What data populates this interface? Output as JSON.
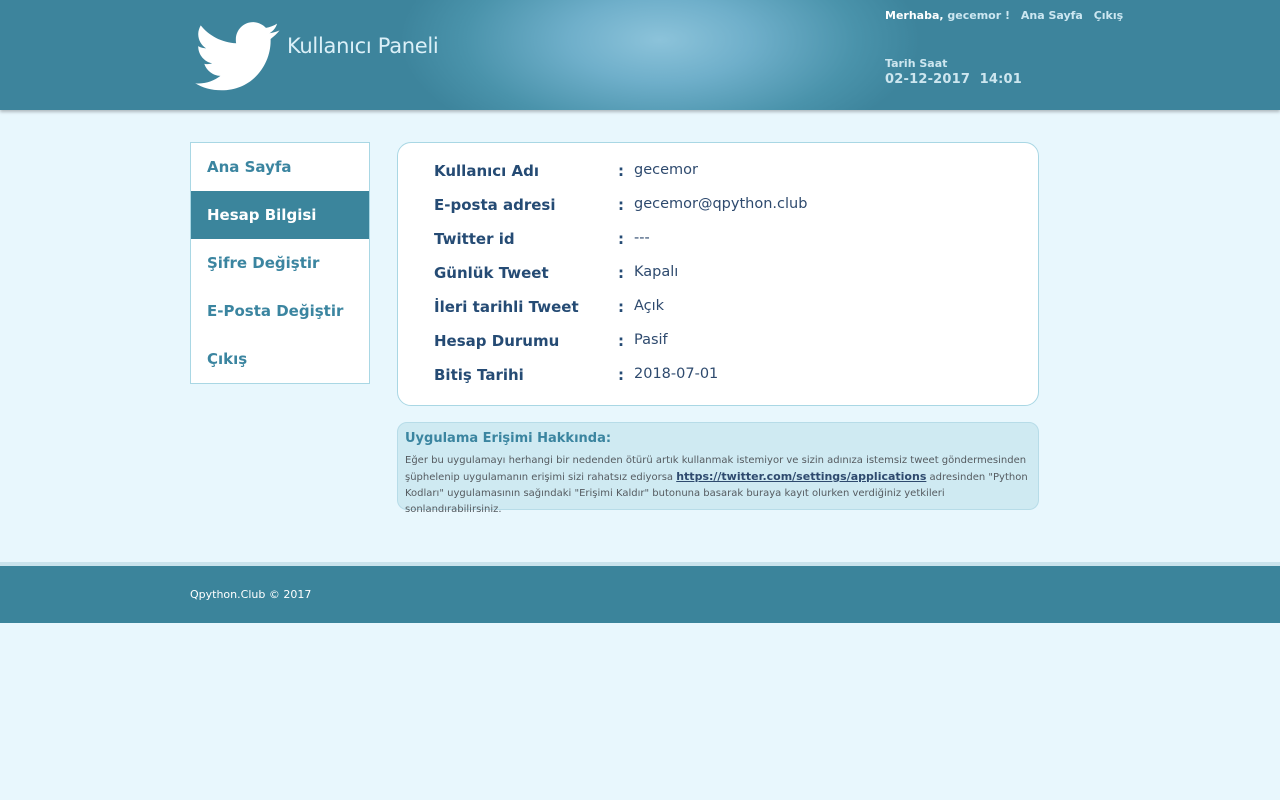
{
  "header": {
    "app_title": "Kullanıcı Paneli",
    "greeting_prefix": "Merhaba,",
    "username": "gecemor !",
    "links": [
      "Ana Sayfa",
      "Çıkış"
    ],
    "datetime_label": "Tarih Saat",
    "datetime_value": "02-12-2017  14:01"
  },
  "sidebar": {
    "items": [
      {
        "label": "Ana Sayfa"
      },
      {
        "label": "Hesap Bilgisi"
      },
      {
        "label": "Şifre Değiştir"
      },
      {
        "label": "E-Posta Değiştir"
      },
      {
        "label": "Çıkış"
      }
    ],
    "active_index": 1
  },
  "account": {
    "rows": [
      {
        "label": "Kullanıcı Adı",
        "value": "gecemor"
      },
      {
        "label": "E-posta adresi",
        "value": "gecemor@qpython.club"
      },
      {
        "label": "Twitter id",
        "value": "---"
      },
      {
        "label": "Günlük Tweet",
        "value": "Kapalı"
      },
      {
        "label": "İleri tarihli Tweet",
        "value": "Açık"
      },
      {
        "label": "Hesap Durumu",
        "value": "Pasif"
      },
      {
        "label": "Bitiş Tarihi",
        "value": "2018-07-01"
      }
    ]
  },
  "notice": {
    "title": "Uygulama Erişimi Hakkında:",
    "text_before": "Eğer bu uygulamayı herhangi bir nedenden ötürü artık kullanmak istemiyor ve sizin adınıza istemsiz tweet göndermesinden şüphelenip uygulamanın erişimi sizi rahatsız ediyorsa ",
    "link_text": "https://twitter.com/settings/applications",
    "text_after": " adresinden \"Python Kodları\" uygulamasının sağındaki \"Erişimi Kaldır\" butonuna basarak buraya kayıt olurken verdiğiniz yetkileri sonlandırabilirsiniz."
  },
  "footer": {
    "copyright": "Qpython.Club © 2017"
  },
  "colors": {
    "header": "#3d849c",
    "page_background": "#e8f7fd",
    "accent": "#3b859c",
    "label_text": "#254b74"
  }
}
